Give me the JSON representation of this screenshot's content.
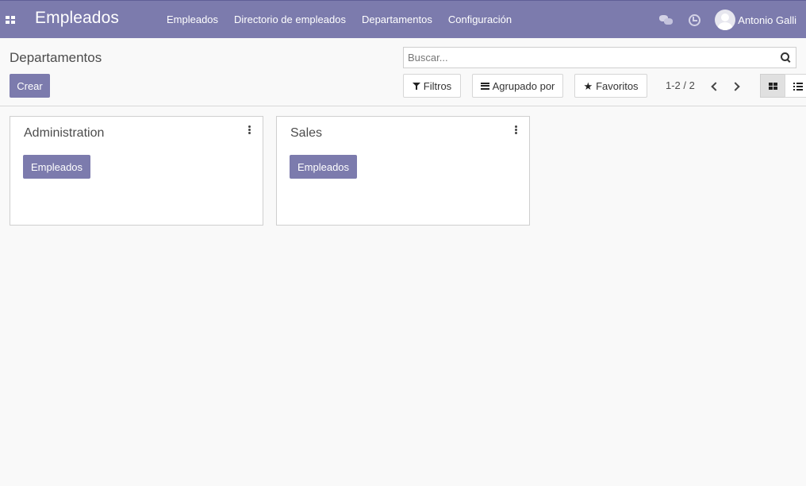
{
  "navbar": {
    "app_title": "Empleados",
    "menu": [
      {
        "label": "Empleados"
      },
      {
        "label": "Directorio de empleados"
      },
      {
        "label": "Departamentos"
      },
      {
        "label": "Configuración"
      }
    ],
    "user_name": "Antonio Galli",
    "icons": [
      "apps-icon",
      "chat-icon",
      "clock-icon",
      "avatar"
    ]
  },
  "control_panel": {
    "breadcrumb": "Departamentos",
    "create_label": "Crear",
    "search": {
      "value": "",
      "placeholder": "Buscar..."
    },
    "filters_label": "Filtros",
    "group_by_label": "Agrupado por",
    "favorites_label": "Favoritos",
    "pager": "1-2 / 2",
    "views": [
      "kanban",
      "list"
    ],
    "active_view": "kanban"
  },
  "departments": [
    {
      "name": "Administration",
      "button_label": "Empleados"
    },
    {
      "name": "Sales",
      "button_label": "Empleados"
    }
  ],
  "colors": {
    "brand": "#7c7bad",
    "background": "#f9f9f9"
  }
}
